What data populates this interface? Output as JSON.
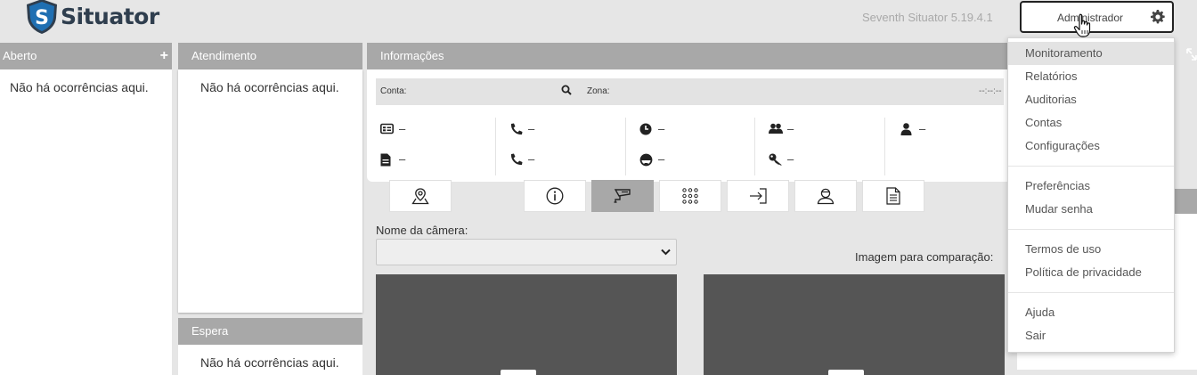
{
  "app": {
    "logo_text": "Situator",
    "logo_letter": "S",
    "version": "Seventh Situator 5.19.4.1"
  },
  "user_menu": {
    "button_label": "Administrador",
    "items": [
      {
        "label": "Monitoramento",
        "highlighted": true
      },
      {
        "label": "Relatórios"
      },
      {
        "label": "Auditorias"
      },
      {
        "label": "Contas"
      },
      {
        "label": "Configurações"
      },
      {
        "label": "Preferências"
      },
      {
        "label": "Mudar senha"
      },
      {
        "label": "Termos de uso"
      },
      {
        "label": "Política de privacidade"
      },
      {
        "label": "Ajuda"
      },
      {
        "label": "Sair"
      }
    ]
  },
  "panels": {
    "aberto": {
      "title": "Aberto",
      "add_symbol": "+",
      "empty": "Não há ocorrências aqui."
    },
    "atendimento": {
      "title": "Atendimento",
      "empty": "Não há ocorrências aqui."
    },
    "espera": {
      "title": "Espera",
      "empty": "Não há ocorrências aqui."
    }
  },
  "info": {
    "title": "Informações",
    "conta_label": "Conta:",
    "zona_label": "Zona:",
    "time": "--:--:--",
    "cells": [
      "–",
      "–",
      "–",
      "–",
      "–",
      "–",
      "–",
      "–",
      "–"
    ]
  },
  "camera": {
    "name_label": "Nome da câmera:",
    "selected": "",
    "compare_label": "Imagem para comparação:"
  },
  "colors": {
    "panel_header": "#a8a8a8",
    "accent_dark": "#2f3e4e",
    "shield": "#1f6fb2",
    "camera_bg": "#555555"
  }
}
